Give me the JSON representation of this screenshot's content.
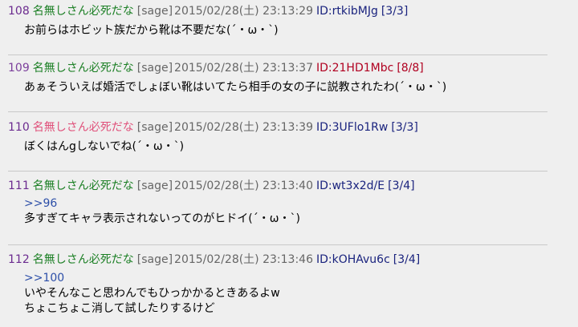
{
  "posts": [
    {
      "number": "108",
      "name": "名無しさん必死だな",
      "mail": "[sage]",
      "date": "2015/02/28(土) 23:13:29",
      "id": "ID:rtkibMJg",
      "count": "[3/3]",
      "lines": [
        "お前らはホビット族だから靴は不要だな(´・ω・`)"
      ]
    },
    {
      "number": "109",
      "name": "名無しさん必死だな",
      "mail": "[sage]",
      "date": "2015/02/28(土) 23:13:37",
      "id": "ID:21HD1Mbc",
      "count": "[8/8]",
      "lines": [
        "あぁそういえば婚活でしょぼい靴はいてたら相手の女の子に説教されたわ(´・ω・`)"
      ]
    },
    {
      "number": "110",
      "name": "名無しさん必死だな",
      "mail": "[sage]",
      "date": "2015/02/28(土) 23:13:39",
      "id": "ID:3UFlo1Rw",
      "count": "[3/3]",
      "lines": [
        "ぼくはんgしないでね(´・ω・`)"
      ]
    },
    {
      "number": "111",
      "name": "名無しさん必死だな",
      "mail": "[sage]",
      "date": "2015/02/28(土) 23:13:40",
      "id": "ID:wt3x2d/E",
      "count": "[3/4]",
      "anchor": ">>96",
      "lines": [
        "多すぎてキャラ表示されないってのがヒドイ(´・ω・`)"
      ]
    },
    {
      "number": "112",
      "name": "名無しさん必死だな",
      "mail": "[sage]",
      "date": "2015/02/28(土) 23:13:46",
      "id": "ID:kOHAvu6c",
      "count": "[3/4]",
      "anchor": ">>100",
      "lines": [
        "いやそんなこと思わんでもひっかかるときあるよw",
        "ちょこちょこ消して試したりするけど"
      ]
    }
  ],
  "colors": {
    "background": "#efefef",
    "name_green": "#1b7f24",
    "name_pink": "#e0507a",
    "id_blue": "#1a237e",
    "id_red": "#b00020",
    "anchor_blue": "#2d4fa8",
    "date_gray": "#666666"
  }
}
